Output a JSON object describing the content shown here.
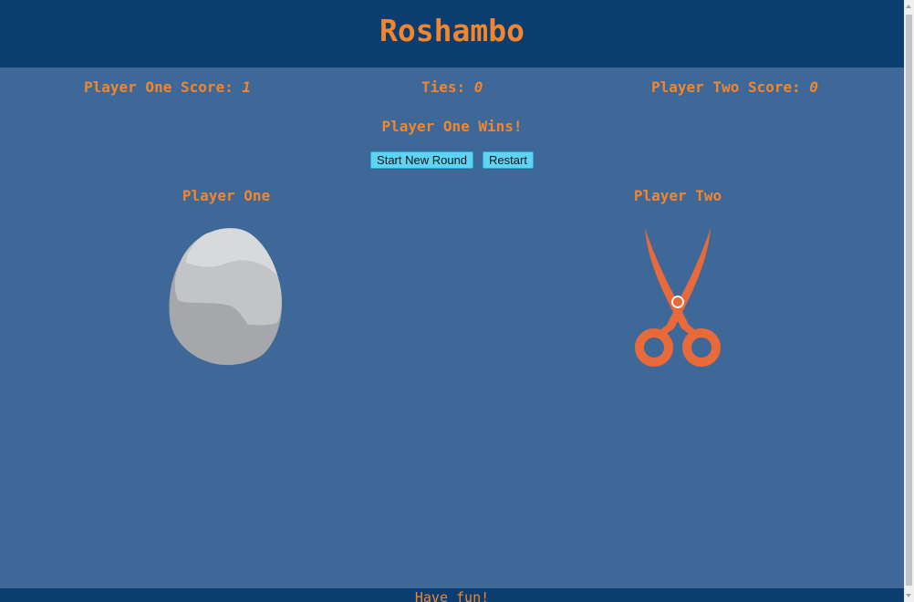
{
  "header": {
    "title": "Roshambo"
  },
  "scores": {
    "player_one_label": "Player One Score: ",
    "player_one_value": "1",
    "ties_label": "Ties: ",
    "ties_value": "0",
    "player_two_label": "Player Two Score: ",
    "player_two_value": "0"
  },
  "result": {
    "message": "Player One Wins!"
  },
  "controls": {
    "start_new_round_label": "Start New Round",
    "restart_label": "Restart"
  },
  "players": {
    "one": {
      "label": "Player One",
      "choice_icon": "rock-icon"
    },
    "two": {
      "label": "Player Two",
      "choice_icon": "scissors-icon"
    }
  },
  "footer": {
    "text": "Have fun!"
  },
  "colors": {
    "background": "#3e6897",
    "header_bg": "#0b3d70",
    "accent_text": "#f1862f",
    "button_bg": "#5fd3f3"
  }
}
